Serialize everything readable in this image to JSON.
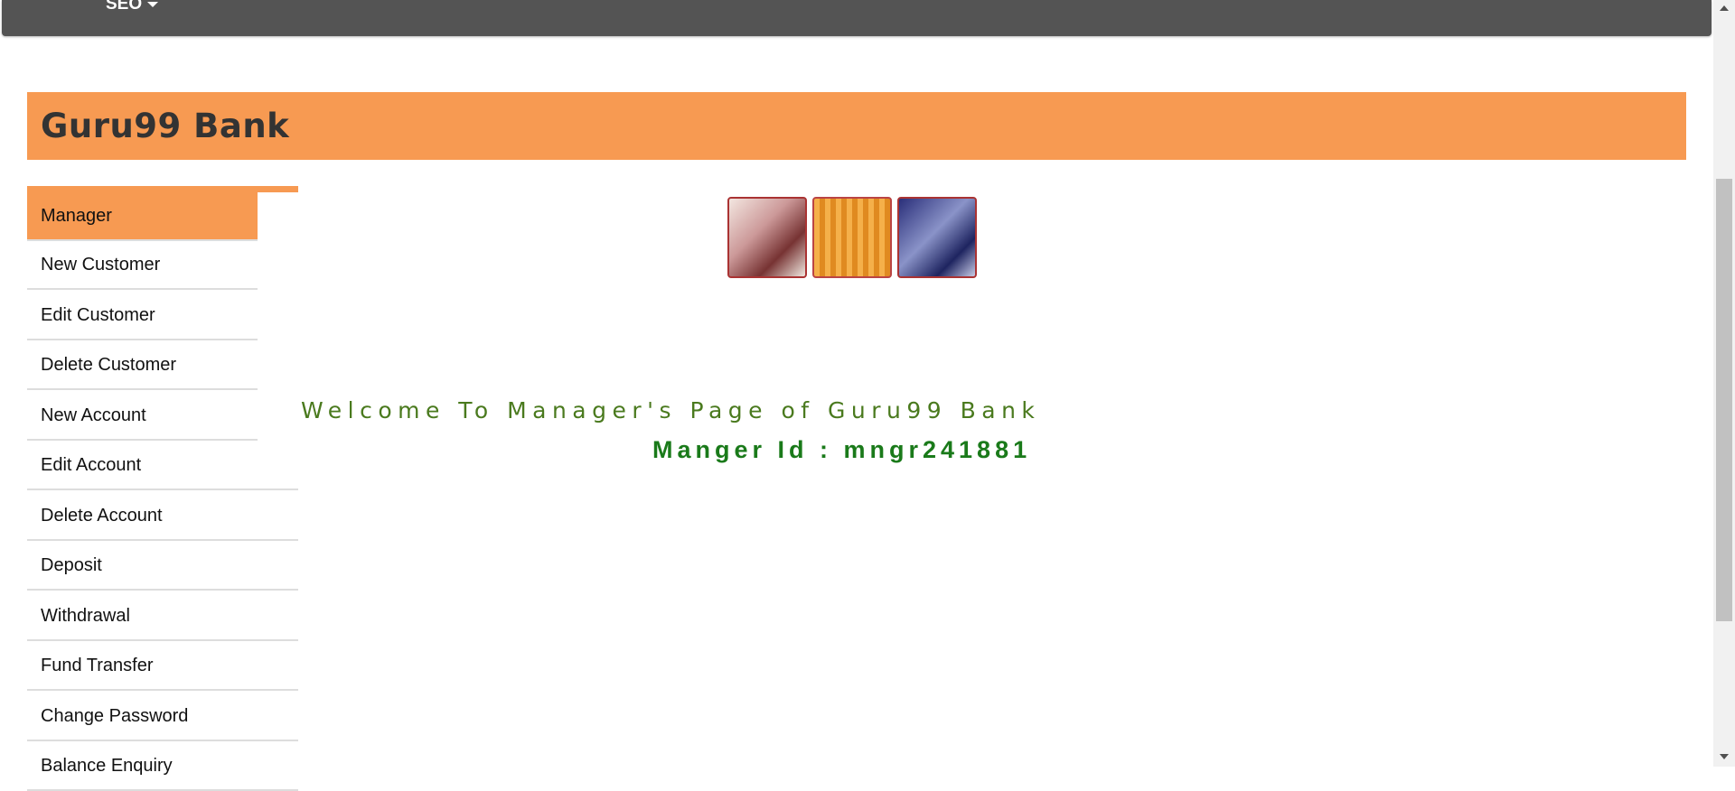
{
  "topnav": {
    "seo_label": "SEO"
  },
  "banner": {
    "title": "Guru99 Bank"
  },
  "menu": {
    "items": [
      {
        "label": "Manager",
        "active": true
      },
      {
        "label": "New Customer"
      },
      {
        "label": "Edit Customer"
      },
      {
        "label": "Delete Customer"
      },
      {
        "label": "New Account"
      },
      {
        "label": "Edit Account"
      },
      {
        "label": "Delete Account"
      },
      {
        "label": "Deposit"
      },
      {
        "label": "Withdrawal"
      },
      {
        "label": "Fund Transfer"
      },
      {
        "label": "Change Password"
      },
      {
        "label": "Balance Enquiry"
      }
    ]
  },
  "main": {
    "welcome_text": "Welcome To Manager's Page of Guru99 Bank",
    "manager_id_text": "Manger Id : mngr241881"
  },
  "colors": {
    "accent": "#f79a52",
    "topnav_bg": "#545454",
    "welcome_text": "#4a7a1e",
    "manager_id_text": "#1a7a1a"
  }
}
